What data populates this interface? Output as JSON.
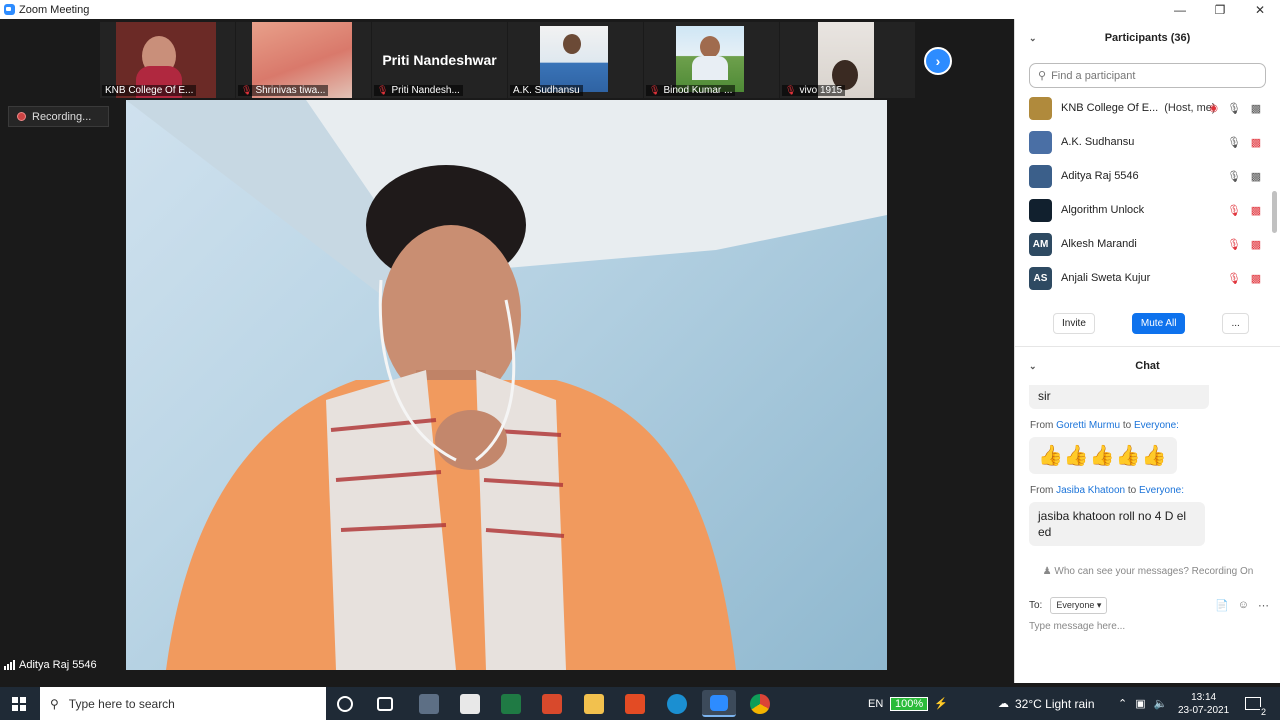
{
  "window": {
    "title": "Zoom Meeting"
  },
  "thumbnails": [
    {
      "name": "KNB College Of E...",
      "muted": false
    },
    {
      "name": "Shrinivas tiwa...",
      "muted": true
    },
    {
      "name": "Priti Nandesh...",
      "muted": true,
      "display_name": "Priti Nandeshwar"
    },
    {
      "name": "A.K. Sudhansu",
      "muted": false
    },
    {
      "name": "Binod Kumar ...",
      "muted": true
    },
    {
      "name": "vivo 1915",
      "muted": true
    }
  ],
  "recording_label": "Recording...",
  "active_speaker": "Aditya Raj 5546",
  "participants": {
    "title": "Participants (36)",
    "search_placeholder": "Find a participant",
    "list": [
      {
        "name": "KNB College Of E...",
        "tag": "(Host, me)",
        "avatar_initials": "",
        "avatar_color": "#b08a3c",
        "mic": "on",
        "video": "on",
        "recording": true
      },
      {
        "name": "A.K. Sudhansu",
        "tag": "",
        "avatar_initials": "",
        "avatar_color": "#4a6fa5",
        "mic": "on",
        "video": "off"
      },
      {
        "name": "Aditya Raj 5546",
        "tag": "",
        "avatar_initials": "",
        "avatar_color": "#3b5f8a",
        "mic": "on",
        "video": "on"
      },
      {
        "name": "Algorithm Unlock",
        "tag": "",
        "avatar_initials": "",
        "avatar_color": "#11202e",
        "mic": "off",
        "video": "off"
      },
      {
        "name": "Alkesh Marandi",
        "tag": "",
        "avatar_initials": "AM",
        "avatar_color": "#2e4a62",
        "mic": "off",
        "video": "off"
      },
      {
        "name": "Anjali Sweta Kujur",
        "tag": "",
        "avatar_initials": "AS",
        "avatar_color": "#2e4a62",
        "mic": "off",
        "video": "off"
      }
    ],
    "invite_label": "Invite",
    "mute_all_label": "Mute All",
    "more_label": "..."
  },
  "chat": {
    "title": "Chat",
    "prev_message": "sir",
    "messages": [
      {
        "from_word": "From",
        "sender": "Goretti Murmu",
        "to_word": "to",
        "recipient": "Everyone:",
        "text": "👍👍👍👍👍"
      },
      {
        "from_word": "From",
        "sender": "Jasiba Khatoon",
        "to_word": "to",
        "recipient": "Everyone:",
        "text": "jasiba khatoon roll no 4 D el ed"
      }
    ],
    "visibility_note": "Who can see your messages? Recording On",
    "to_label": "To:",
    "to_value": "Everyone",
    "input_placeholder": "Type message here..."
  },
  "taskbar": {
    "search_placeholder": "Type here to search",
    "language": "EN",
    "battery": "100%",
    "weather": "32°C  Light rain",
    "time": "13:14",
    "date": "23-07-2021",
    "notifications": "2"
  },
  "colors": {
    "accent": "#2d8cff",
    "primary_button": "#0e72ed",
    "muted_red": "#e0323a"
  }
}
